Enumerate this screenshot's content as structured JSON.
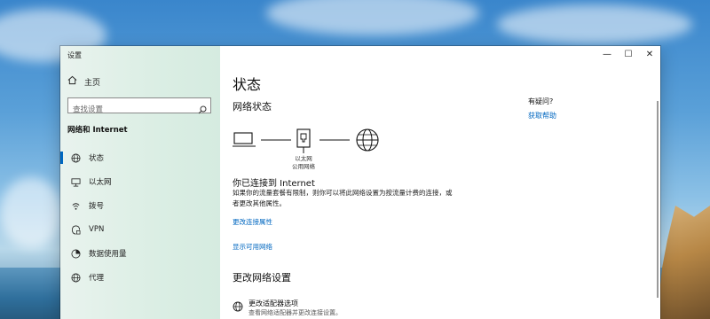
{
  "window": {
    "title": "设置"
  },
  "sidebar": {
    "home_label": "主页",
    "search_placeholder": "查找设置",
    "section_title": "网络和 Internet",
    "items": [
      {
        "label": "状态",
        "icon": "status-globe-icon",
        "active": true
      },
      {
        "label": "以太网",
        "icon": "ethernet-icon",
        "active": false
      },
      {
        "label": "拨号",
        "icon": "dialup-icon",
        "active": false
      },
      {
        "label": "VPN",
        "icon": "vpn-icon",
        "active": false
      },
      {
        "label": "数据使用量",
        "icon": "data-usage-icon",
        "active": false
      },
      {
        "label": "代理",
        "icon": "globe-icon",
        "active": false
      }
    ]
  },
  "main": {
    "page_title": "状态",
    "network_status_heading": "网络状态",
    "diagram": {
      "adapter_label": "以太网",
      "network_label": "公用网络"
    },
    "connected_title": "你已连接到 Internet",
    "connected_desc": "如果你的流量套餐有限制，则你可以将此网络设置为按流量计费的连接，或者更改其他属性。",
    "link_change_properties": "更改连接属性",
    "link_show_networks": "显示可用网络",
    "change_settings_heading": "更改网络设置",
    "adapter_option_title": "更改适配器选项",
    "adapter_option_desc": "查看网络适配器并更改连接设置。",
    "help_question": "有疑问?",
    "help_link": "获取帮助"
  },
  "title_controls": {
    "minimize": "—",
    "maximize": "☐",
    "close": "✕"
  },
  "colors": {
    "accent": "#0067c0",
    "sidebar_bg": "#dbeee4"
  }
}
